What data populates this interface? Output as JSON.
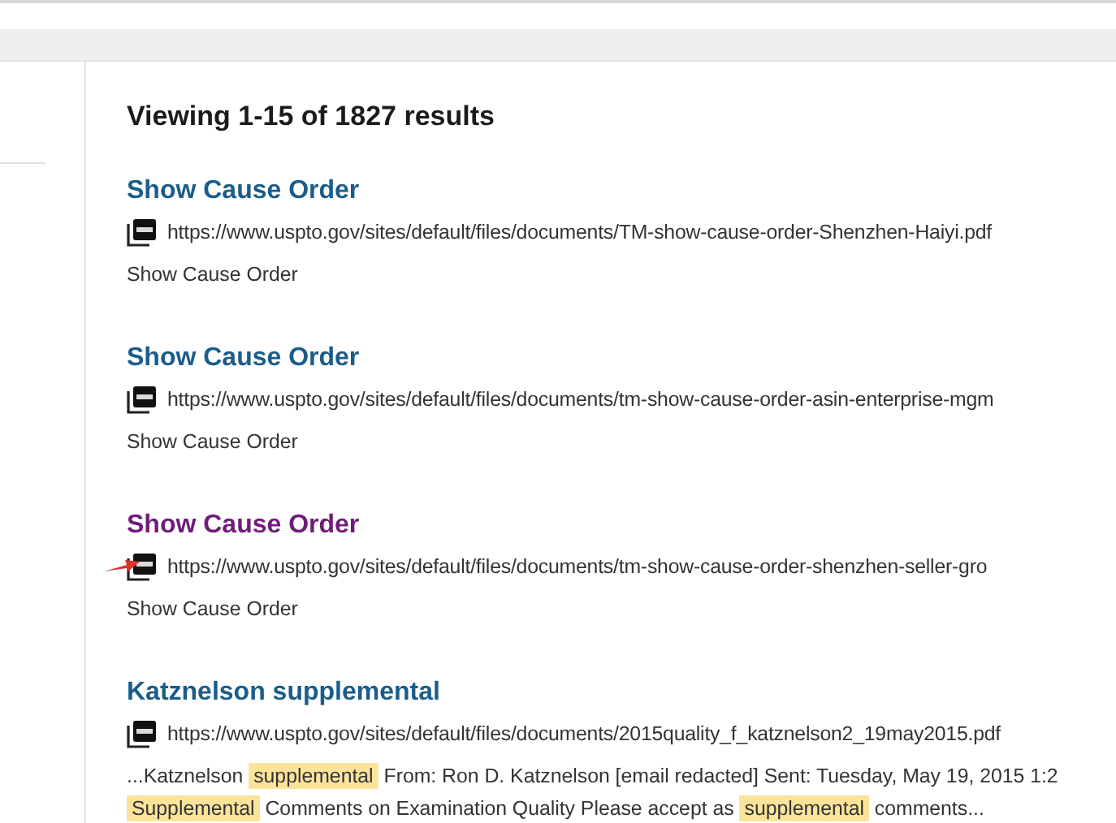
{
  "heading": "Viewing 1-15 of 1827 results",
  "results": [
    {
      "title": "Show Cause Order",
      "visited": false,
      "marked": false,
      "url": "https://www.uspto.gov/sites/default/files/documents/TM-show-cause-order-Shenzhen-Haiyi.pdf",
      "snippet": [
        {
          "text": "Show Cause Order",
          "highlighted": false
        }
      ]
    },
    {
      "title": "Show Cause Order",
      "visited": false,
      "marked": false,
      "url": "https://www.uspto.gov/sites/default/files/documents/tm-show-cause-order-asin-enterprise-mgm",
      "snippet": [
        {
          "text": "Show Cause Order",
          "highlighted": false
        }
      ]
    },
    {
      "title": "Show Cause Order",
      "visited": true,
      "marked": true,
      "url": "https://www.uspto.gov/sites/default/files/documents/tm-show-cause-order-shenzhen-seller-gro",
      "snippet": [
        {
          "text": "Show Cause Order",
          "highlighted": false
        }
      ]
    },
    {
      "title": "Katznelson supplemental",
      "visited": false,
      "marked": false,
      "url": "https://www.uspto.gov/sites/default/files/documents/2015quality_f_katznelson2_19may2015.pdf",
      "snippet": [
        {
          "text": "...Katznelson",
          "highlighted": false
        },
        {
          "text": "supplemental",
          "highlighted": true
        },
        {
          "text": "From: Ron D. Katznelson [email redacted] Sent: Tuesday, May 19, 2015 1:2",
          "highlighted": false
        },
        {
          "text": "Supplemental",
          "highlighted": true
        },
        {
          "text": "Comments on Examination Quality Please accept as",
          "highlighted": false
        },
        {
          "text": "supplemental",
          "highlighted": true
        },
        {
          "text": "comments...",
          "highlighted": false
        }
      ]
    }
  ]
}
